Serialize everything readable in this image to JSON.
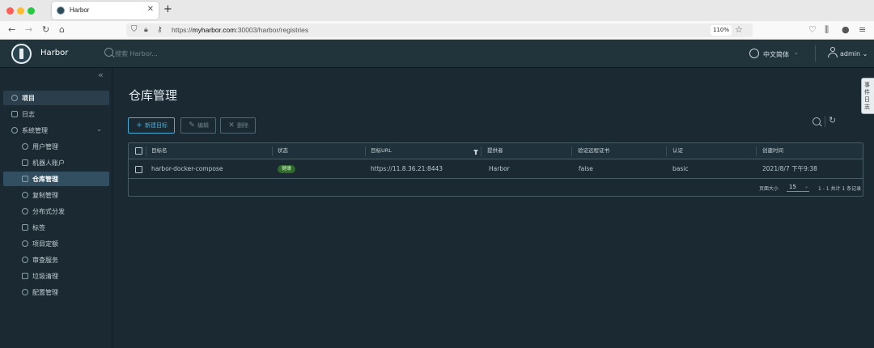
{
  "browser": {
    "tab_title": "Harbor",
    "url_prefix": "https://",
    "url_host": "myharbor.com",
    "url_path": ":30003/harbor/registries",
    "zoom": "110%"
  },
  "header": {
    "brand": "Harbor",
    "search_placeholder": "搜索 Harbor...",
    "language": "中文简体",
    "user": "admin"
  },
  "sidebar": {
    "items": [
      {
        "label": "项目"
      },
      {
        "label": "日志"
      },
      {
        "label": "系统管理"
      }
    ],
    "sub_items": [
      {
        "label": "用户管理"
      },
      {
        "label": "机器人账户"
      },
      {
        "label": "仓库管理"
      },
      {
        "label": "复制管理"
      },
      {
        "label": "分布式分发"
      },
      {
        "label": "标签"
      },
      {
        "label": "项目定额"
      },
      {
        "label": "审查服务"
      },
      {
        "label": "垃圾清理"
      },
      {
        "label": "配置管理"
      }
    ]
  },
  "main": {
    "title": "仓库管理",
    "buttons": {
      "new": "新建目标",
      "edit": "编辑",
      "delete": "删除"
    },
    "columns": [
      "目标名",
      "状态",
      "目标URL",
      "提供者",
      "验证远程证书",
      "认证",
      "创建时间"
    ],
    "rows": [
      {
        "name": "harbor-docker-compose",
        "status": "健康",
        "url": "https://11.8.36.21:8443",
        "provider": "Harbor",
        "verify_cert": "false",
        "auth": "basic",
        "created": "2021/8/7 下午9:38"
      }
    ],
    "pagination": {
      "page_size_label": "页面大小",
      "page_size": "15",
      "summary": "1 - 1 共计 1 条记录"
    }
  },
  "side_tab": "事件日志"
}
